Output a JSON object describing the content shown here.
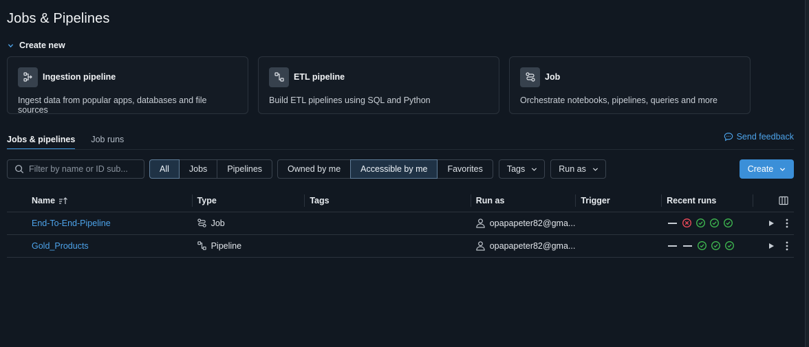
{
  "page": {
    "title": "Jobs & Pipelines"
  },
  "create_new": {
    "label": "Create new",
    "cards": [
      {
        "icon": "ingestion-pipeline-icon",
        "title": "Ingestion pipeline",
        "description": "Ingest data from popular apps, databases and file sources"
      },
      {
        "icon": "etl-pipeline-icon",
        "title": "ETL pipeline",
        "description": "Build ETL pipelines using SQL and Python"
      },
      {
        "icon": "job-icon",
        "title": "Job",
        "description": "Orchestrate notebooks, pipelines, queries and more"
      }
    ]
  },
  "tabs": [
    {
      "label": "Jobs & pipelines",
      "active": true
    },
    {
      "label": "Job runs",
      "active": false
    }
  ],
  "feedback": {
    "label": "Send feedback"
  },
  "filters": {
    "search_placeholder": "Filter by name or ID sub...",
    "type_options": [
      "All",
      "Jobs",
      "Pipelines"
    ],
    "type_selected": "All",
    "owner_options": [
      "Owned by me",
      "Accessible by me",
      "Favorites"
    ],
    "owner_selected": "Accessible by me",
    "tags_label": "Tags",
    "run_as_label": "Run as"
  },
  "create_button": {
    "label": "Create"
  },
  "table": {
    "columns": [
      "Name",
      "Type",
      "Tags",
      "Run as",
      "Trigger",
      "Recent runs"
    ],
    "rows": [
      {
        "name": "End-To-End-Pipeline",
        "type": "Job",
        "type_icon": "job-icon",
        "tags": "",
        "run_as": "opapapeter82@gma...",
        "trigger": "",
        "recent_runs": [
          "none",
          "failed",
          "success",
          "success",
          "success"
        ]
      },
      {
        "name": "Gold_Products",
        "type": "Pipeline",
        "type_icon": "pipeline-icon",
        "tags": "",
        "run_as": "opapapeter82@gma...",
        "trigger": "",
        "recent_runs": [
          "none",
          "none",
          "success",
          "success",
          "success"
        ]
      }
    ]
  },
  "colors": {
    "accent": "#3b8fd8",
    "link": "#4da3ea",
    "success": "#3fb950",
    "failed": "#f04a5a",
    "background": "#111821"
  }
}
